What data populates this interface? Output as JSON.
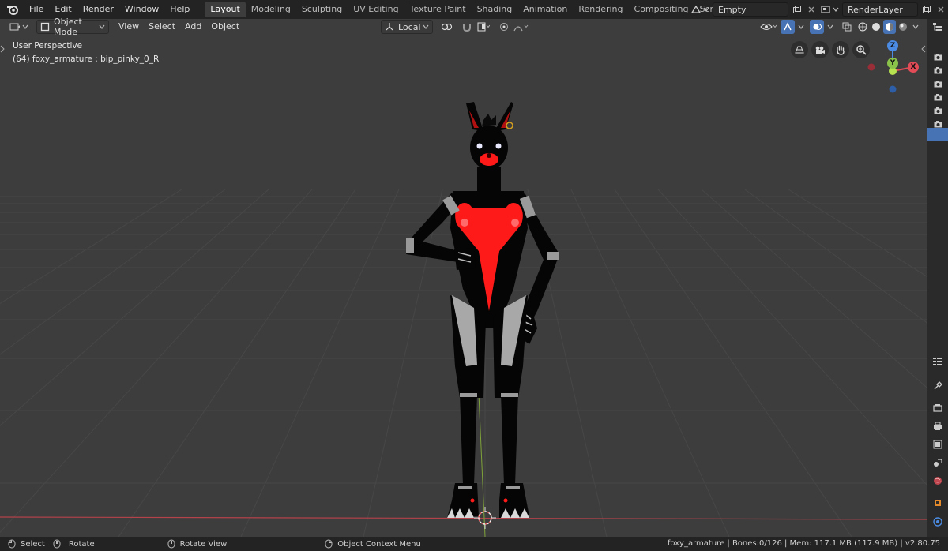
{
  "topbar": {
    "menu": [
      "File",
      "Edit",
      "Render",
      "Window",
      "Help"
    ],
    "workspaces": [
      "Layout",
      "Modeling",
      "Sculpting",
      "UV Editing",
      "Texture Paint",
      "Shading",
      "Animation",
      "Rendering",
      "Compositing",
      "Scripting"
    ],
    "active_workspace": "Layout",
    "add_tab": "+",
    "scene_name": "Empty",
    "view_layer": "RenderLayer"
  },
  "viewport_header": {
    "mode": "Object Mode",
    "menus": [
      "View",
      "Select",
      "Add",
      "Object"
    ],
    "transform_orientation": "Local"
  },
  "viewport": {
    "perspective_label": "User Perspective",
    "object_info": "(64) foxy_armature : bip_pinky_0_R",
    "gizmo_axes": {
      "z": "Z",
      "y": "Y",
      "x": "X"
    },
    "colors": {
      "x_axis": "#e34b57",
      "y_axis": "#8bc34a",
      "z_axis": "#4b8be3",
      "grid": "#4a4a4a",
      "body": "#050505",
      "accent": "#ff1a1a"
    }
  },
  "statusbar": {
    "select": "Select",
    "rotate": "Rotate",
    "rotate_view": "Rotate View",
    "context_menu": "Object Context Menu",
    "stats": "foxy_armature | Bones:0/126 | Mem: 117.1 MB (117.9 MB) | v2.80.75"
  }
}
